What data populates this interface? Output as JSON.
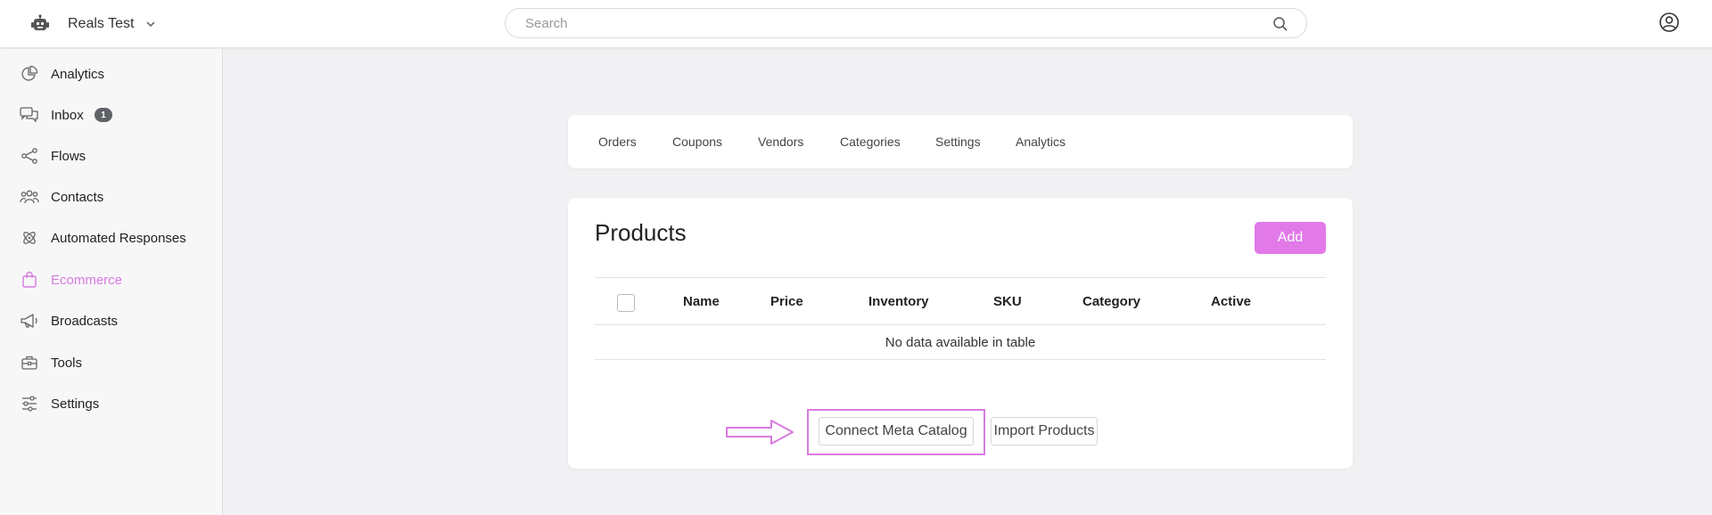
{
  "header": {
    "app_icon": "robot-icon",
    "workspace_name": "Reals Test",
    "search_placeholder": "Search"
  },
  "sidebar": {
    "items": [
      {
        "label": "Analytics",
        "icon": "pie-chart-icon"
      },
      {
        "label": "Inbox",
        "icon": "chat-bubbles-icon",
        "badge": "1"
      },
      {
        "label": "Flows",
        "icon": "flow-nodes-icon"
      },
      {
        "label": "Contacts",
        "icon": "people-icon"
      },
      {
        "label": "Automated Responses",
        "icon": "atom-icon"
      },
      {
        "label": "Ecommerce",
        "icon": "shopping-bag-icon",
        "active": true
      },
      {
        "label": "Broadcasts",
        "icon": "megaphone-icon"
      },
      {
        "label": "Tools",
        "icon": "toolbox-icon"
      },
      {
        "label": "Settings",
        "icon": "sliders-icon"
      }
    ]
  },
  "tabs": [
    "Orders",
    "Coupons",
    "Vendors",
    "Categories",
    "Settings",
    "Analytics"
  ],
  "products": {
    "title": "Products",
    "add_label": "Add",
    "columns": [
      "Name",
      "Price",
      "Inventory",
      "SKU",
      "Category",
      "Active"
    ],
    "empty_message": "No data available in table",
    "connect_label": "Connect Meta Catalog",
    "import_label": "Import Products"
  },
  "colors": {
    "accent": "#e179e8",
    "annotation": "#d77be0"
  }
}
